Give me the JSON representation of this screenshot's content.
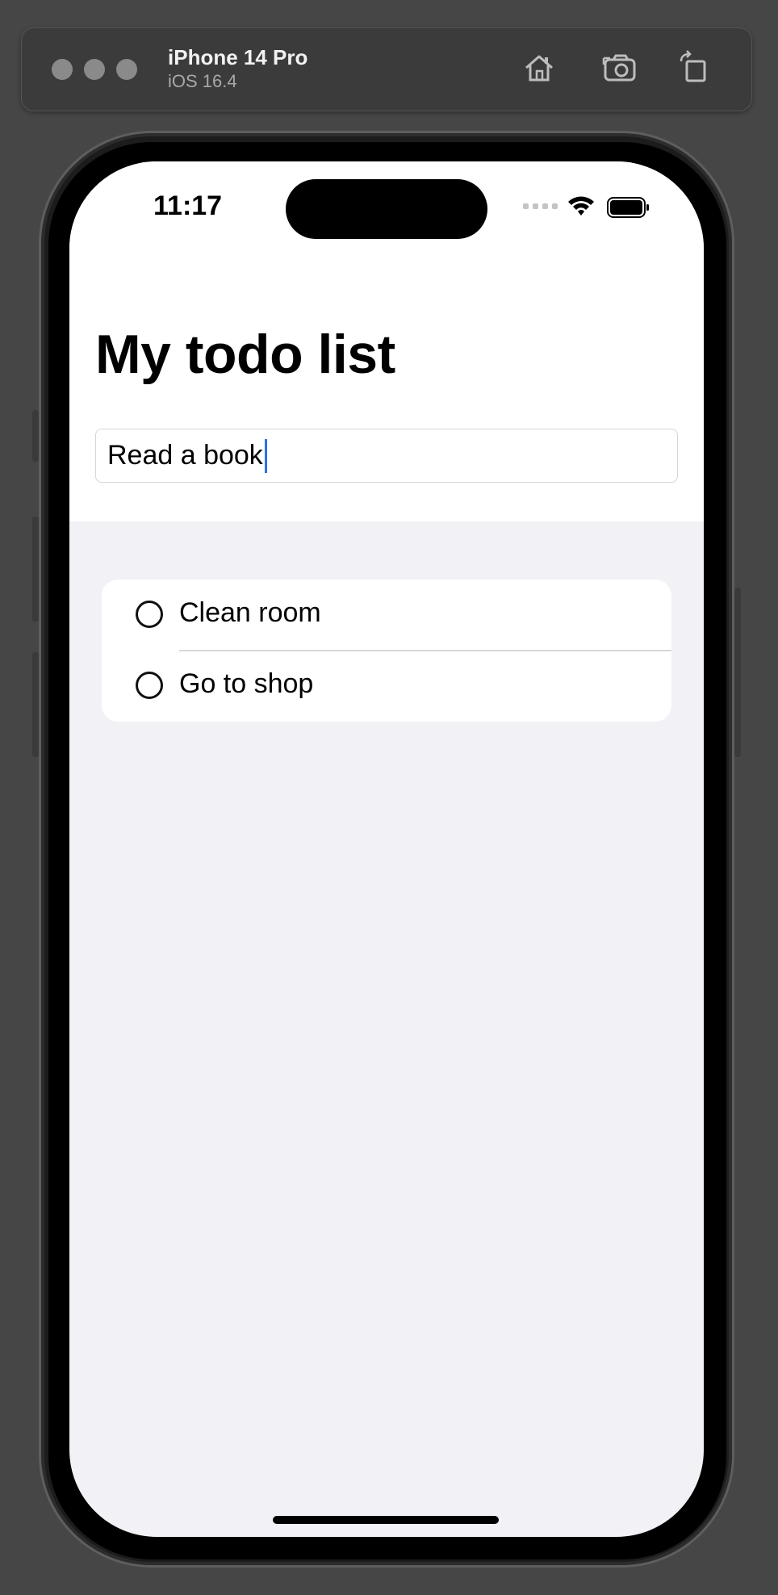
{
  "simulator": {
    "device_name": "iPhone 14 Pro",
    "os_version": "iOS 16.4",
    "toolbar": [
      "home-icon",
      "screenshot-icon",
      "rotate-icon"
    ]
  },
  "status_bar": {
    "time": "11:17",
    "icons": [
      "cellular-signal-icon",
      "wifi-icon",
      "battery-icon"
    ]
  },
  "app": {
    "title": "My todo list",
    "new_todo_input": {
      "value": "Read a book",
      "placeholder": ""
    },
    "todos": [
      {
        "label": "Clean room",
        "done": false
      },
      {
        "label": "Go to shop",
        "done": false
      }
    ]
  },
  "colors": {
    "caret": "#2f6fe4",
    "list_background": "#f2f1f6"
  }
}
